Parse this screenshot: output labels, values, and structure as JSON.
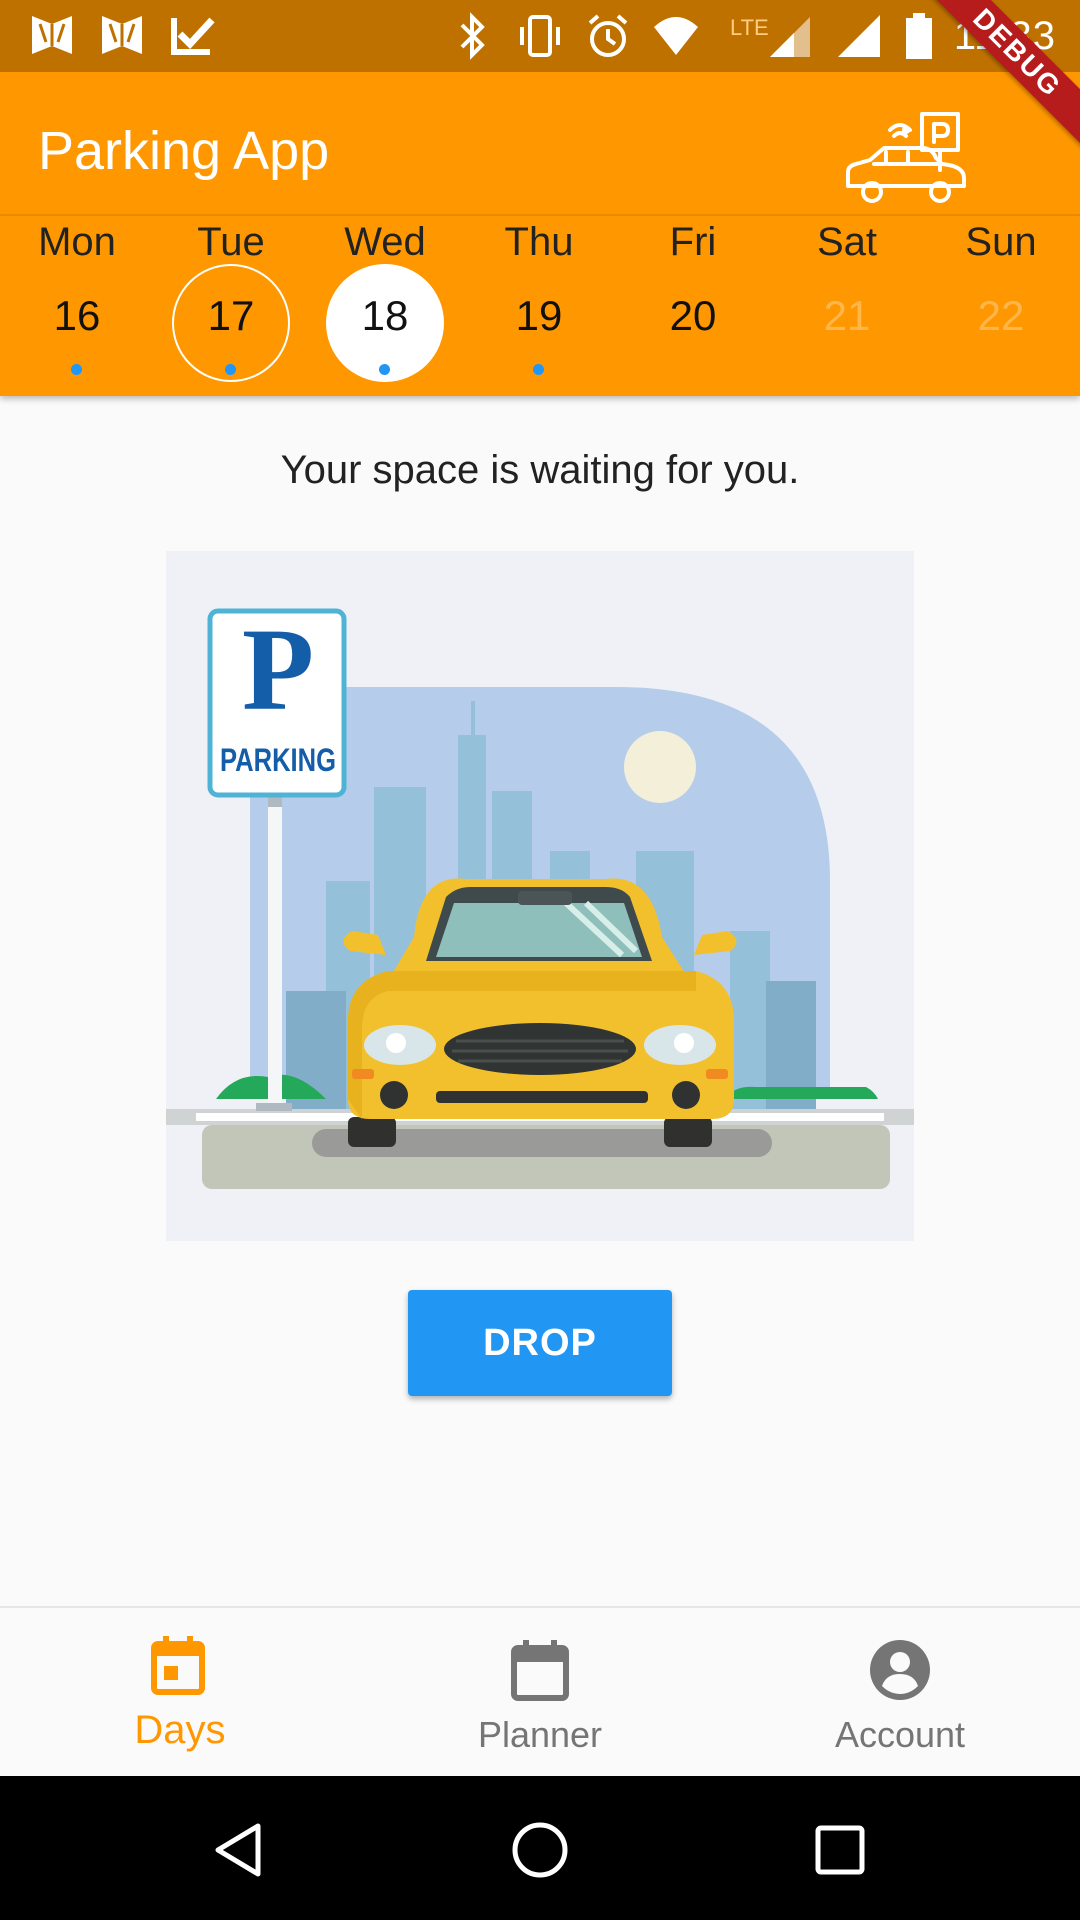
{
  "status_bar": {
    "time": "11:33",
    "network": "LTE",
    "left_icons": [
      "notification-app-icon",
      "notification-app-icon",
      "check-notification-icon"
    ],
    "right_icons": [
      "bluetooth-icon",
      "vibrate-icon",
      "alarm-icon",
      "wifi-icon",
      "signal-icon",
      "signal-icon",
      "battery-icon"
    ],
    "debug_banner": "DEBUG"
  },
  "app_bar": {
    "title": "Parking App",
    "logo_icon": "smart-parking-car-icon"
  },
  "days": [
    {
      "name": "Mon",
      "num": "16",
      "has_event": true,
      "state": "normal"
    },
    {
      "name": "Tue",
      "num": "17",
      "has_event": true,
      "state": "today"
    },
    {
      "name": "Wed",
      "num": "18",
      "has_event": true,
      "state": "selected"
    },
    {
      "name": "Thu",
      "num": "19",
      "has_event": true,
      "state": "normal"
    },
    {
      "name": "Fri",
      "num": "20",
      "has_event": false,
      "state": "normal"
    },
    {
      "name": "Sat",
      "num": "21",
      "has_event": false,
      "state": "disabled"
    },
    {
      "name": "Sun",
      "num": "22",
      "has_event": false,
      "state": "disabled"
    }
  ],
  "main": {
    "message": "Your space is waiting for you.",
    "illustration": {
      "sign_letter": "P",
      "sign_text": "PARKING"
    },
    "drop_button": "DROP"
  },
  "bottom_nav": {
    "items": [
      {
        "label": "Days",
        "icon": "calendar-today-icon",
        "active": true
      },
      {
        "label": "Planner",
        "icon": "calendar-icon",
        "active": false
      },
      {
        "label": "Account",
        "icon": "account-circle-icon",
        "active": false
      }
    ]
  },
  "colors": {
    "accent": "#ff9800",
    "status_bar": "#bf7100",
    "primary_button": "#2196f3",
    "event_dot": "#2196f3"
  }
}
